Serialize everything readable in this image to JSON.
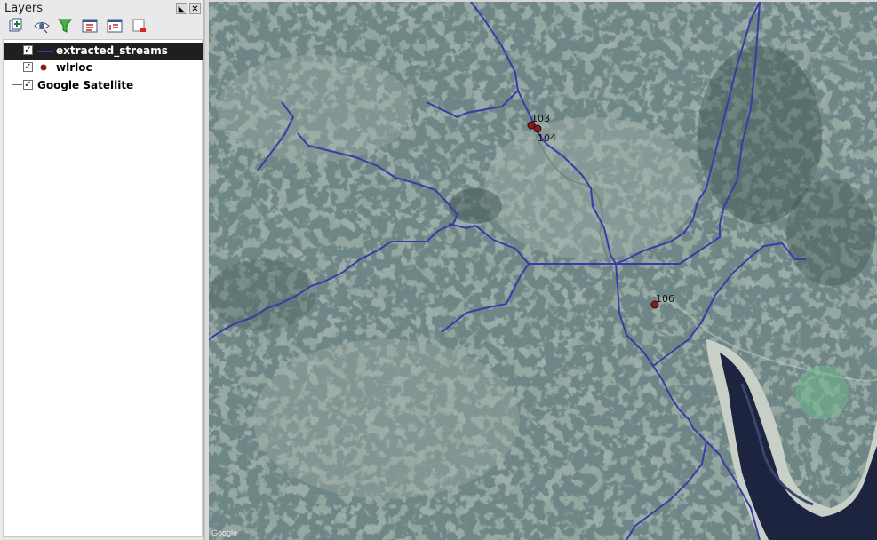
{
  "panel": {
    "title": "Layers",
    "float_btn": "◣",
    "close_btn": "✕",
    "toolbar": [
      {
        "name": "add-group-icon",
        "title": "Add group"
      },
      {
        "name": "manage-visibility-icon",
        "title": "Manage layer visibility"
      },
      {
        "name": "filter-legend-icon",
        "title": "Filter legend"
      },
      {
        "name": "expand-all-icon",
        "title": "Expand all"
      },
      {
        "name": "collapse-all-icon",
        "title": "Collapse all"
      },
      {
        "name": "remove-layer-icon",
        "title": "Remove layer"
      }
    ]
  },
  "layers": [
    {
      "label": "extracted_streams",
      "checked": true,
      "selected": true,
      "symbol": "line",
      "symbol_color": "#3b3aa6"
    },
    {
      "label": "wlrloc",
      "checked": true,
      "selected": false,
      "symbol": "point",
      "symbol_color": "#8b1a1a"
    },
    {
      "label": "Google Satellite",
      "checked": true,
      "selected": false,
      "symbol": "none"
    }
  ],
  "map": {
    "stream_color": "#3b3aa6",
    "point_color": "#8b1a1a",
    "points": [
      {
        "label": "103"
      },
      {
        "label": "104"
      },
      {
        "label": "106"
      }
    ],
    "attribution": "Google"
  }
}
